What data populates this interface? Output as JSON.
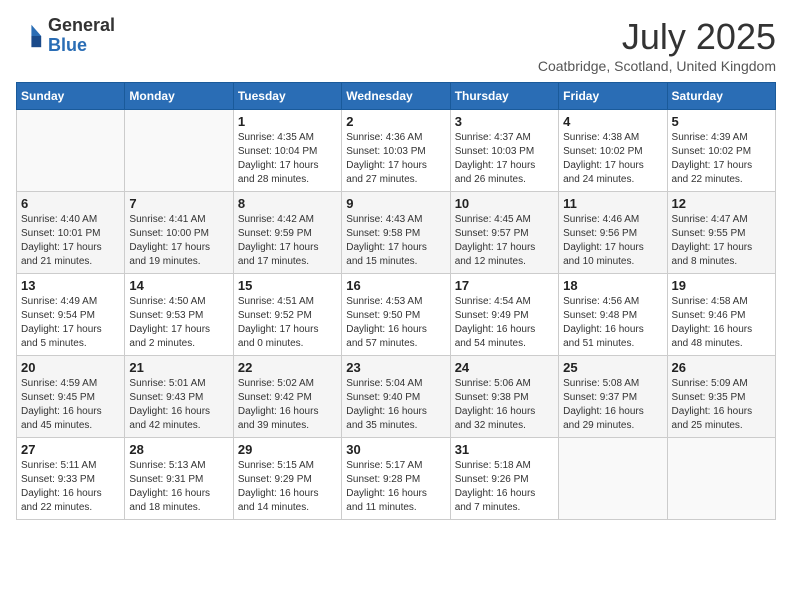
{
  "logo": {
    "general": "General",
    "blue": "Blue"
  },
  "title": "July 2025",
  "location": "Coatbridge, Scotland, United Kingdom",
  "days_of_week": [
    "Sunday",
    "Monday",
    "Tuesday",
    "Wednesday",
    "Thursday",
    "Friday",
    "Saturday"
  ],
  "weeks": [
    [
      {
        "day": "",
        "info": ""
      },
      {
        "day": "",
        "info": ""
      },
      {
        "day": "1",
        "info": "Sunrise: 4:35 AM\nSunset: 10:04 PM\nDaylight: 17 hours and 28 minutes."
      },
      {
        "day": "2",
        "info": "Sunrise: 4:36 AM\nSunset: 10:03 PM\nDaylight: 17 hours and 27 minutes."
      },
      {
        "day": "3",
        "info": "Sunrise: 4:37 AM\nSunset: 10:03 PM\nDaylight: 17 hours and 26 minutes."
      },
      {
        "day": "4",
        "info": "Sunrise: 4:38 AM\nSunset: 10:02 PM\nDaylight: 17 hours and 24 minutes."
      },
      {
        "day": "5",
        "info": "Sunrise: 4:39 AM\nSunset: 10:02 PM\nDaylight: 17 hours and 22 minutes."
      }
    ],
    [
      {
        "day": "6",
        "info": "Sunrise: 4:40 AM\nSunset: 10:01 PM\nDaylight: 17 hours and 21 minutes."
      },
      {
        "day": "7",
        "info": "Sunrise: 4:41 AM\nSunset: 10:00 PM\nDaylight: 17 hours and 19 minutes."
      },
      {
        "day": "8",
        "info": "Sunrise: 4:42 AM\nSunset: 9:59 PM\nDaylight: 17 hours and 17 minutes."
      },
      {
        "day": "9",
        "info": "Sunrise: 4:43 AM\nSunset: 9:58 PM\nDaylight: 17 hours and 15 minutes."
      },
      {
        "day": "10",
        "info": "Sunrise: 4:45 AM\nSunset: 9:57 PM\nDaylight: 17 hours and 12 minutes."
      },
      {
        "day": "11",
        "info": "Sunrise: 4:46 AM\nSunset: 9:56 PM\nDaylight: 17 hours and 10 minutes."
      },
      {
        "day": "12",
        "info": "Sunrise: 4:47 AM\nSunset: 9:55 PM\nDaylight: 17 hours and 8 minutes."
      }
    ],
    [
      {
        "day": "13",
        "info": "Sunrise: 4:49 AM\nSunset: 9:54 PM\nDaylight: 17 hours and 5 minutes."
      },
      {
        "day": "14",
        "info": "Sunrise: 4:50 AM\nSunset: 9:53 PM\nDaylight: 17 hours and 2 minutes."
      },
      {
        "day": "15",
        "info": "Sunrise: 4:51 AM\nSunset: 9:52 PM\nDaylight: 17 hours and 0 minutes."
      },
      {
        "day": "16",
        "info": "Sunrise: 4:53 AM\nSunset: 9:50 PM\nDaylight: 16 hours and 57 minutes."
      },
      {
        "day": "17",
        "info": "Sunrise: 4:54 AM\nSunset: 9:49 PM\nDaylight: 16 hours and 54 minutes."
      },
      {
        "day": "18",
        "info": "Sunrise: 4:56 AM\nSunset: 9:48 PM\nDaylight: 16 hours and 51 minutes."
      },
      {
        "day": "19",
        "info": "Sunrise: 4:58 AM\nSunset: 9:46 PM\nDaylight: 16 hours and 48 minutes."
      }
    ],
    [
      {
        "day": "20",
        "info": "Sunrise: 4:59 AM\nSunset: 9:45 PM\nDaylight: 16 hours and 45 minutes."
      },
      {
        "day": "21",
        "info": "Sunrise: 5:01 AM\nSunset: 9:43 PM\nDaylight: 16 hours and 42 minutes."
      },
      {
        "day": "22",
        "info": "Sunrise: 5:02 AM\nSunset: 9:42 PM\nDaylight: 16 hours and 39 minutes."
      },
      {
        "day": "23",
        "info": "Sunrise: 5:04 AM\nSunset: 9:40 PM\nDaylight: 16 hours and 35 minutes."
      },
      {
        "day": "24",
        "info": "Sunrise: 5:06 AM\nSunset: 9:38 PM\nDaylight: 16 hours and 32 minutes."
      },
      {
        "day": "25",
        "info": "Sunrise: 5:08 AM\nSunset: 9:37 PM\nDaylight: 16 hours and 29 minutes."
      },
      {
        "day": "26",
        "info": "Sunrise: 5:09 AM\nSunset: 9:35 PM\nDaylight: 16 hours and 25 minutes."
      }
    ],
    [
      {
        "day": "27",
        "info": "Sunrise: 5:11 AM\nSunset: 9:33 PM\nDaylight: 16 hours and 22 minutes."
      },
      {
        "day": "28",
        "info": "Sunrise: 5:13 AM\nSunset: 9:31 PM\nDaylight: 16 hours and 18 minutes."
      },
      {
        "day": "29",
        "info": "Sunrise: 5:15 AM\nSunset: 9:29 PM\nDaylight: 16 hours and 14 minutes."
      },
      {
        "day": "30",
        "info": "Sunrise: 5:17 AM\nSunset: 9:28 PM\nDaylight: 16 hours and 11 minutes."
      },
      {
        "day": "31",
        "info": "Sunrise: 5:18 AM\nSunset: 9:26 PM\nDaylight: 16 hours and 7 minutes."
      },
      {
        "day": "",
        "info": ""
      },
      {
        "day": "",
        "info": ""
      }
    ]
  ]
}
